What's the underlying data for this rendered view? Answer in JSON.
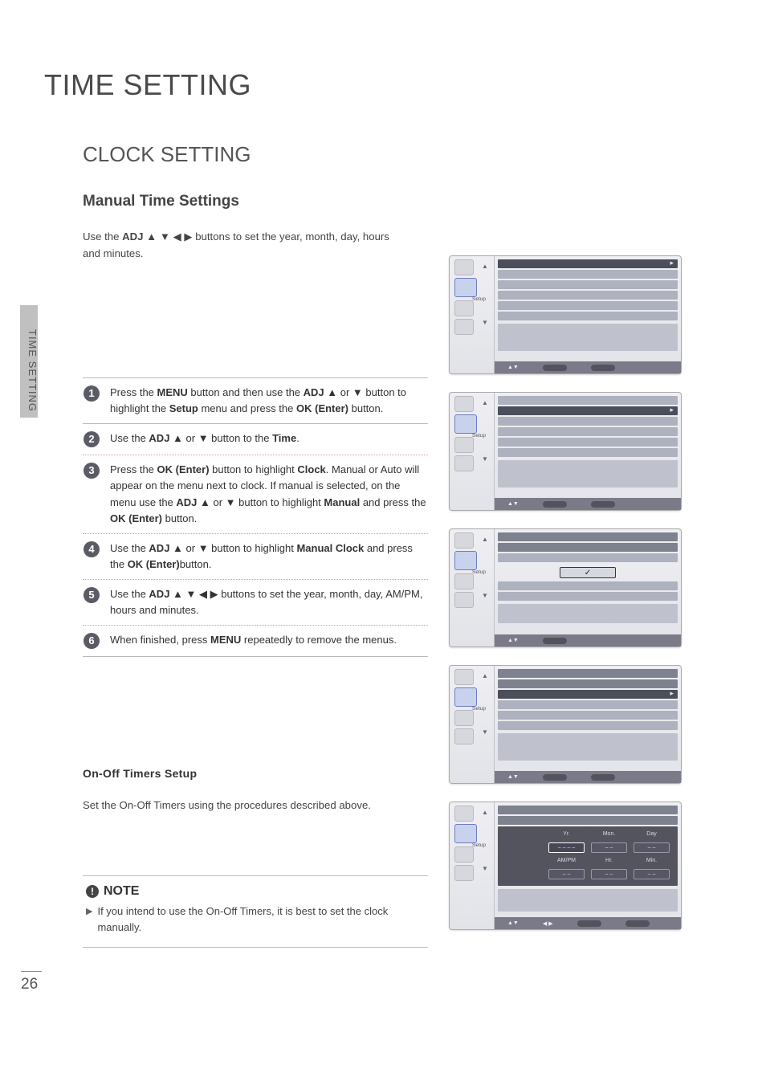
{
  "page": {
    "title": "TIME SETTING",
    "section1": "CLOCK SETTING",
    "section2": "Manual Time Settings",
    "intro_a": "Use the ",
    "intro_adj": "ADJ",
    "intro_b": " ▲ ▼ ◀ ▶ buttons to set the year, month, day, hours and minutes.",
    "side": "TIME SETTING",
    "pagenum": "26"
  },
  "steps": [
    {
      "n": "1",
      "parts": [
        "Press the ",
        "MENU",
        " button and then use the ",
        "ADJ",
        " ▲ or ▼ button to highlight the ",
        "Setup",
        " menu and press the ",
        "OK (Enter)",
        " button."
      ]
    },
    {
      "n": "2",
      "parts": [
        "Use the ",
        "ADJ",
        " ▲ or ▼  button to the ",
        "Time",
        "."
      ]
    },
    {
      "n": "3",
      "parts": [
        "Press the ",
        "OK (Enter)",
        " button to highlight ",
        "Clock",
        ". Manual or Auto will appear on the menu next to clock. If manual is selected, on the menu use the ",
        "ADJ",
        " ▲ or ▼ button to highlight ",
        "Manual",
        " and press the ",
        "OK (Enter)",
        " button."
      ]
    },
    {
      "n": "4",
      "parts": [
        "Use the ",
        "ADJ",
        " ▲ or ▼ button to highlight ",
        "Manual Clock",
        " and press the ",
        "OK (Enter)",
        "button."
      ]
    },
    {
      "n": "5",
      "parts": [
        "Use the ",
        "ADJ",
        " ▲ ▼ ◀ ▶ buttons to set the year, month, day, AM/PM, hours and minutes."
      ]
    },
    {
      "n": "6",
      "parts": [
        "When finished, press ",
        "MENU",
        " repeatedly to remove the menus."
      ]
    }
  ],
  "onoff": {
    "head": "On-Off Timers Setup",
    "text": "Set the On-Off Timers using the procedures described above."
  },
  "note": {
    "head": "NOTE",
    "body": "If you intend to use the On-Off Timers, it is best to set the clock manually."
  },
  "osd": {
    "setup": "Setup",
    "check": "✓",
    "fields": {
      "yr": "Yr.",
      "mon": "Mon.",
      "day": "Day",
      "ampm": "AM/PM",
      "hr": "Hr.",
      "min": "Min.",
      "dash": "– – – –",
      "dd": "– –"
    },
    "foot": {
      "ud": "▲▼",
      "lr": "◀ ▶"
    }
  },
  "chart_data": null
}
